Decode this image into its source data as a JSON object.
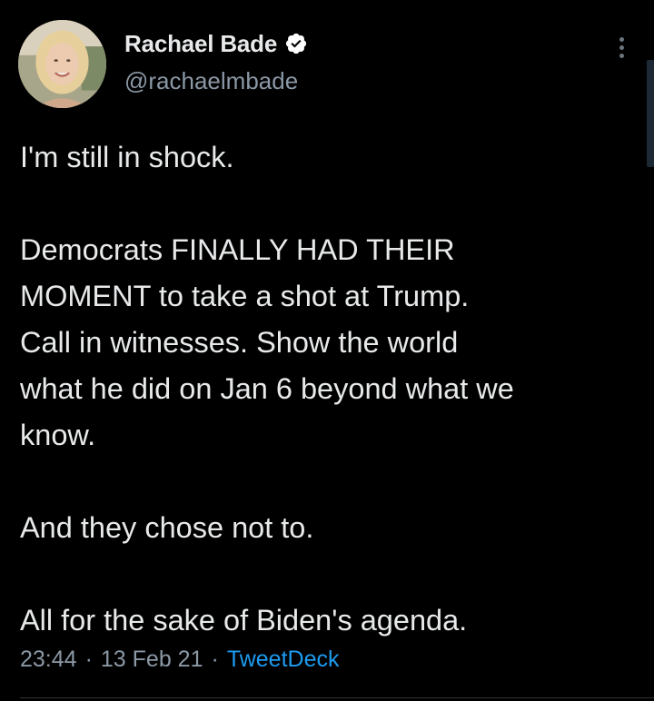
{
  "author": {
    "display_name": "Rachael Bade",
    "handle": "@rachaelmbade",
    "verified": true,
    "verified_color": "#1d9bf0"
  },
  "icons": {
    "verified": "verified-badge-icon",
    "more": "more-options-icon"
  },
  "tweet": {
    "paragraphs": [
      [
        "I'm still in shock."
      ],
      [
        "Democrats FINALLY HAD THEIR",
        "MOMENT to take a shot at Trump.",
        "Call in witnesses. Show the world",
        "what he did on Jan 6 beyond what we",
        "know."
      ],
      [
        "And they chose not to."
      ],
      [
        "All for the sake of Biden's agenda."
      ]
    ],
    "time": "23:44",
    "date": "13 Feb 21",
    "separator": "·",
    "source": "TweetDeck"
  },
  "colors": {
    "background": "#000000",
    "text": "#e7e9ea",
    "secondary_text": "#8b98a5",
    "link": "#1d9bf0"
  }
}
